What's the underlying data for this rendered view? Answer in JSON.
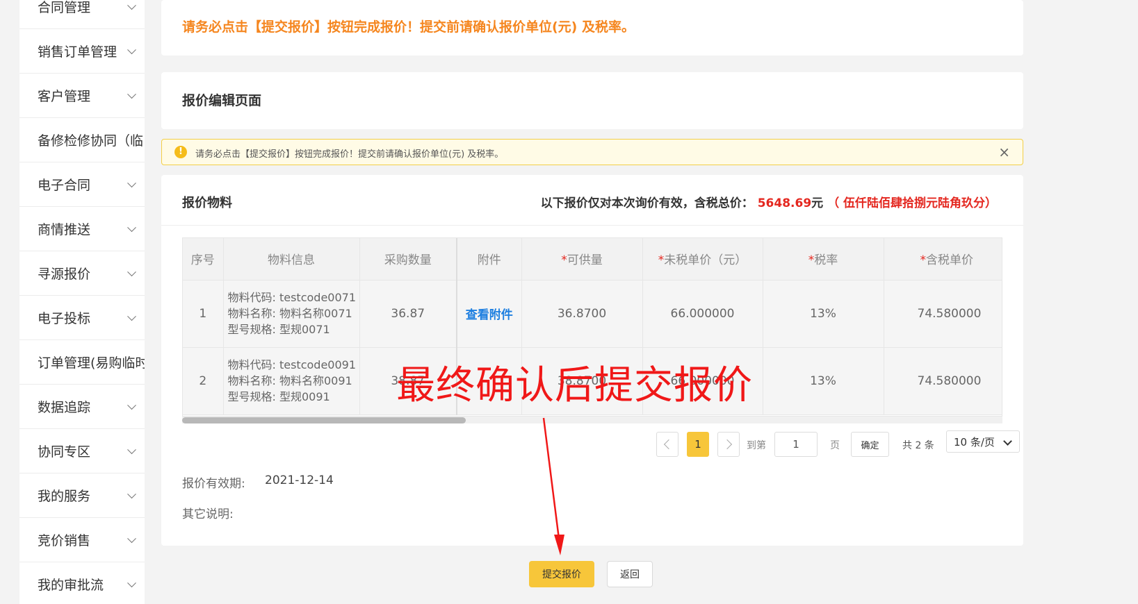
{
  "sidebar": {
    "items": [
      {
        "label": "合同管理"
      },
      {
        "label": "销售订单管理"
      },
      {
        "label": "客户管理"
      },
      {
        "label": "备修检修协同（临"
      },
      {
        "label": "电子合同"
      },
      {
        "label": "商情推送"
      },
      {
        "label": "寻源报价"
      },
      {
        "label": "电子投标"
      },
      {
        "label": "订单管理(易购临时"
      },
      {
        "label": "数据追踪"
      },
      {
        "label": "协同专区"
      },
      {
        "label": "我的服务"
      },
      {
        "label": "竞价销售"
      },
      {
        "label": "我的审批流"
      }
    ]
  },
  "top_notice": "请务必点击【提交报价】按钮完成报价！提交前请确认报价单位(元) 及税率。",
  "edit_title": "报价编辑页面",
  "alert": {
    "text": "请务必点击【提交报价】按钮完成报价！提交前请确认报价单位(元) 及税率。",
    "close": "×",
    "icon": "!"
  },
  "material": {
    "title": "报价物料",
    "total_prefix": "以下报价仅对本次询价有效，含税总价：",
    "total_amount": "5648.69",
    "total_unit": "元",
    "total_words": "（ 伍仟陆佰肆拾捌元陆角玖分）"
  },
  "table": {
    "headers": {
      "seq": "序号",
      "info": "物料信息",
      "qty": "采购数量",
      "attach": "附件",
      "supply": "可供量",
      "untaxed": "未税单价（元）",
      "tax": "税率",
      "taxed": "含税单价"
    },
    "required_mark": "*",
    "rows": [
      {
        "seq": "1",
        "code": "物料代码: testcode0071",
        "name": "物料名称: 物料名称0071",
        "spec": "型号规格: 型规0071",
        "qty": "36.87",
        "attach": "查看附件",
        "supply": "36.8700",
        "untaxed": "66.000000",
        "tax": "13%",
        "taxed": "74.580000"
      },
      {
        "seq": "2",
        "code": "物料代码: testcode0091",
        "name": "物料名称: 物料名称0091",
        "spec": "型号规格: 型规0091",
        "qty": "38.87",
        "attach": "",
        "supply": "38.8700",
        "untaxed": "66.000000",
        "tax": "13%",
        "taxed": "74.580000"
      }
    ]
  },
  "pagination": {
    "current": "1",
    "goto_label": "到第",
    "goto_value": "1",
    "page_unit": "页",
    "confirm": "确定",
    "total": "共 2 条",
    "page_size": "10 条/页"
  },
  "validity_label": "报价有效期:",
  "validity_value": "2021-12-14",
  "notes_label": "其它说明:",
  "buttons": {
    "submit": "提交报价",
    "back": "返回"
  },
  "annotation": "最终确认后提交报价",
  "colors": {
    "accent": "#f7c63a",
    "notice": "#f5861f",
    "price": "#e4271f",
    "link": "#1e7fe0"
  }
}
